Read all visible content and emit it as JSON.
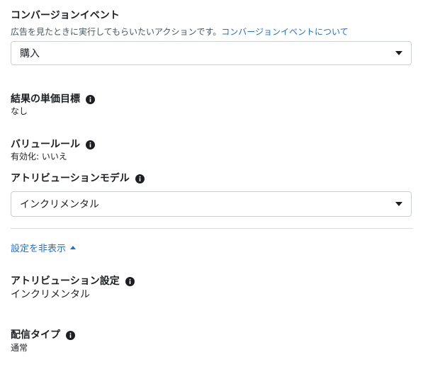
{
  "conversion_event": {
    "heading": "コンバージョンイベント",
    "description": "広告を見たときに実行してもらいたいアクションです。",
    "link": "コンバージョンイベントについて",
    "selected": "購入"
  },
  "result_cost_goal": {
    "heading": "結果の単価目標",
    "value": "なし"
  },
  "value_rules": {
    "heading": "バリュールール",
    "value": "有効化: いいえ"
  },
  "attribution_model": {
    "heading": "アトリビューションモデル",
    "selected": "インクリメンタル"
  },
  "toggle": {
    "label": "設定を非表示"
  },
  "attribution_setting": {
    "heading": "アトリビューション設定",
    "value": "インクリメンタル"
  },
  "delivery_type": {
    "heading": "配信タイプ",
    "value": "通常"
  },
  "colors": {
    "link": "#216fdb",
    "text": "#1c1e21",
    "border": "#ccd0d5"
  }
}
